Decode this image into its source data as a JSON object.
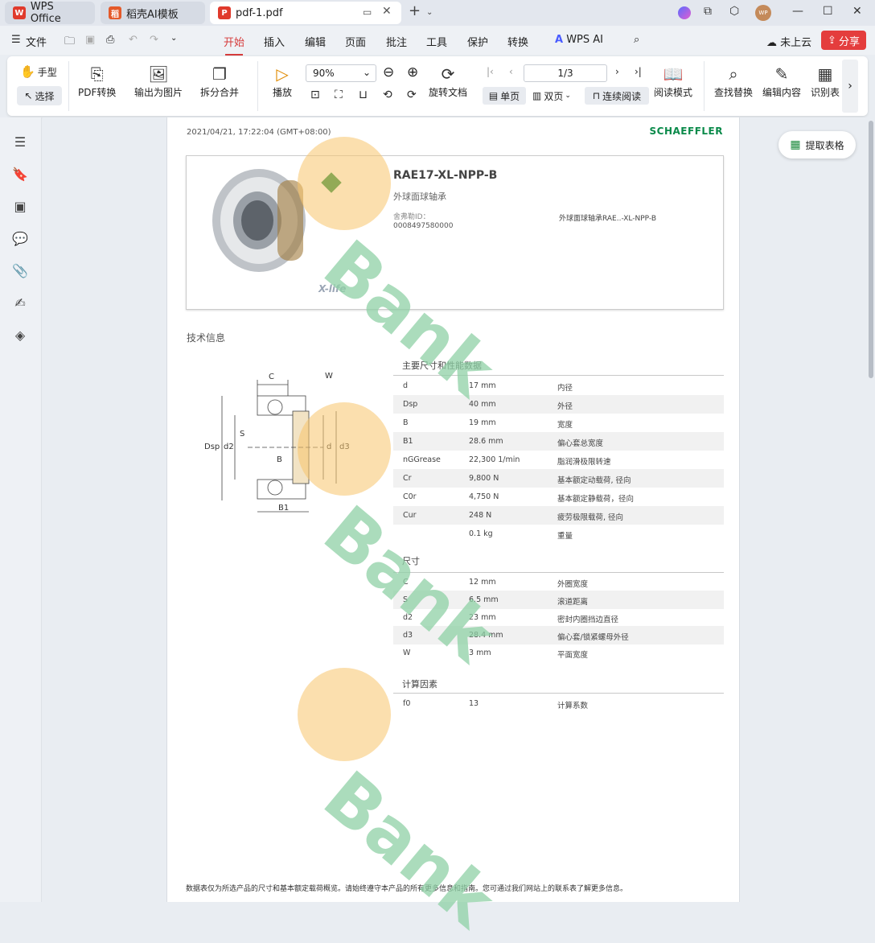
{
  "tabs": [
    {
      "label": "WPS Office",
      "icon": "wps-logo-icon"
    },
    {
      "label": "稻壳AI模板",
      "icon": "docer-icon"
    },
    {
      "label": "pdf-1.pdf",
      "icon": "pdf-icon"
    }
  ],
  "menu": {
    "file_label": "文件",
    "items": [
      "开始",
      "插入",
      "编辑",
      "页面",
      "批注",
      "工具",
      "保护",
      "转换"
    ],
    "active": "开始",
    "wps_ai": "WPS AI",
    "cloud_label": "未上云",
    "share_label": "分享",
    "avatar_text": "WP"
  },
  "toolbar": {
    "hand": "手型",
    "select": "选择",
    "pdf_convert": "PDF转换",
    "export_image": "输出为图片",
    "split_merge": "拆分合并",
    "play": "播放",
    "zoom": "90%",
    "page_indicator": "1/3",
    "rotate": "旋转文档",
    "single": "单页",
    "double": "双页",
    "continuous": "连续阅读",
    "read_mode": "阅读模式",
    "find_replace": "查找替换",
    "edit_content": "编辑内容",
    "recognize_table": "识别表"
  },
  "extract_table": "提取表格",
  "pdf": {
    "timestamp": "2021/04/21, 17:22:04 (GMT+08:00)",
    "brand": "SCHAEFFLER",
    "product_name": "RAE17-XL-NPP-B",
    "product_type": "外球面球轴承",
    "id_label": "舍弗勒ID：",
    "id_value": "0008497580000",
    "product_desc": "外球面球轴承RAE..-XL-NPP-B",
    "xlife": "X-life",
    "tech_info": "技术信息",
    "section_main": "主要尺寸和性能数据",
    "main_rows": [
      {
        "sym": "d",
        "val": "17  mm",
        "desc": "内径"
      },
      {
        "sym": "Dsp",
        "val": "40  mm",
        "desc": "外径"
      },
      {
        "sym": "B",
        "val": "19  mm",
        "desc": "宽度"
      },
      {
        "sym": "B1",
        "val": "28.6  mm",
        "desc": "偏心套总宽度"
      },
      {
        "sym": "nGGrease",
        "val": "22,300  1/min",
        "desc": "脂润滑极限转速"
      },
      {
        "sym": "Cr",
        "val": "9,800  N",
        "desc": "基本额定动载荷, 径向"
      },
      {
        "sym": "C0r",
        "val": "4,750  N",
        "desc": "基本额定静载荷，径向"
      },
      {
        "sym": "Cur",
        "val": "248  N",
        "desc": "疲劳极限载荷, 径向"
      },
      {
        "sym": "",
        "val": "0.1  kg",
        "desc": "重量"
      }
    ],
    "section_dims": "尺寸",
    "dim_rows": [
      {
        "sym": "C",
        "val": "12  mm",
        "desc": "外圈宽度"
      },
      {
        "sym": "S",
        "val": "6.5  mm",
        "desc": "滚道距离"
      },
      {
        "sym": "d2",
        "val": "23  mm",
        "desc": "密封内圈挡边直径"
      },
      {
        "sym": "d3",
        "val": "28.4  mm",
        "desc": "偏心套/锁紧螺母外径"
      },
      {
        "sym": "W",
        "val": "3  mm",
        "desc": "平面宽度"
      }
    ],
    "section_calc": "计算因素",
    "calc_rows": [
      {
        "sym": "f0",
        "val": "13",
        "desc": "计算系数"
      }
    ],
    "footer": "数据表仅为所选产品的尺寸和基本额定载荷概览。请始终遵守本产品的所有更多信息和指南。您可通过我们网站上的联系表了解更多信息。",
    "watermark": "Bank",
    "diagram_labels": [
      "C",
      "W",
      "S",
      "B",
      "Dsp",
      "d2",
      "d",
      "d3",
      "B1"
    ]
  },
  "colors": {
    "accent": "#d63b3b",
    "brand_green": "#0a8a4a",
    "watermark_green": "#8fd1a6",
    "watermark_orange": "#f8c46c"
  }
}
